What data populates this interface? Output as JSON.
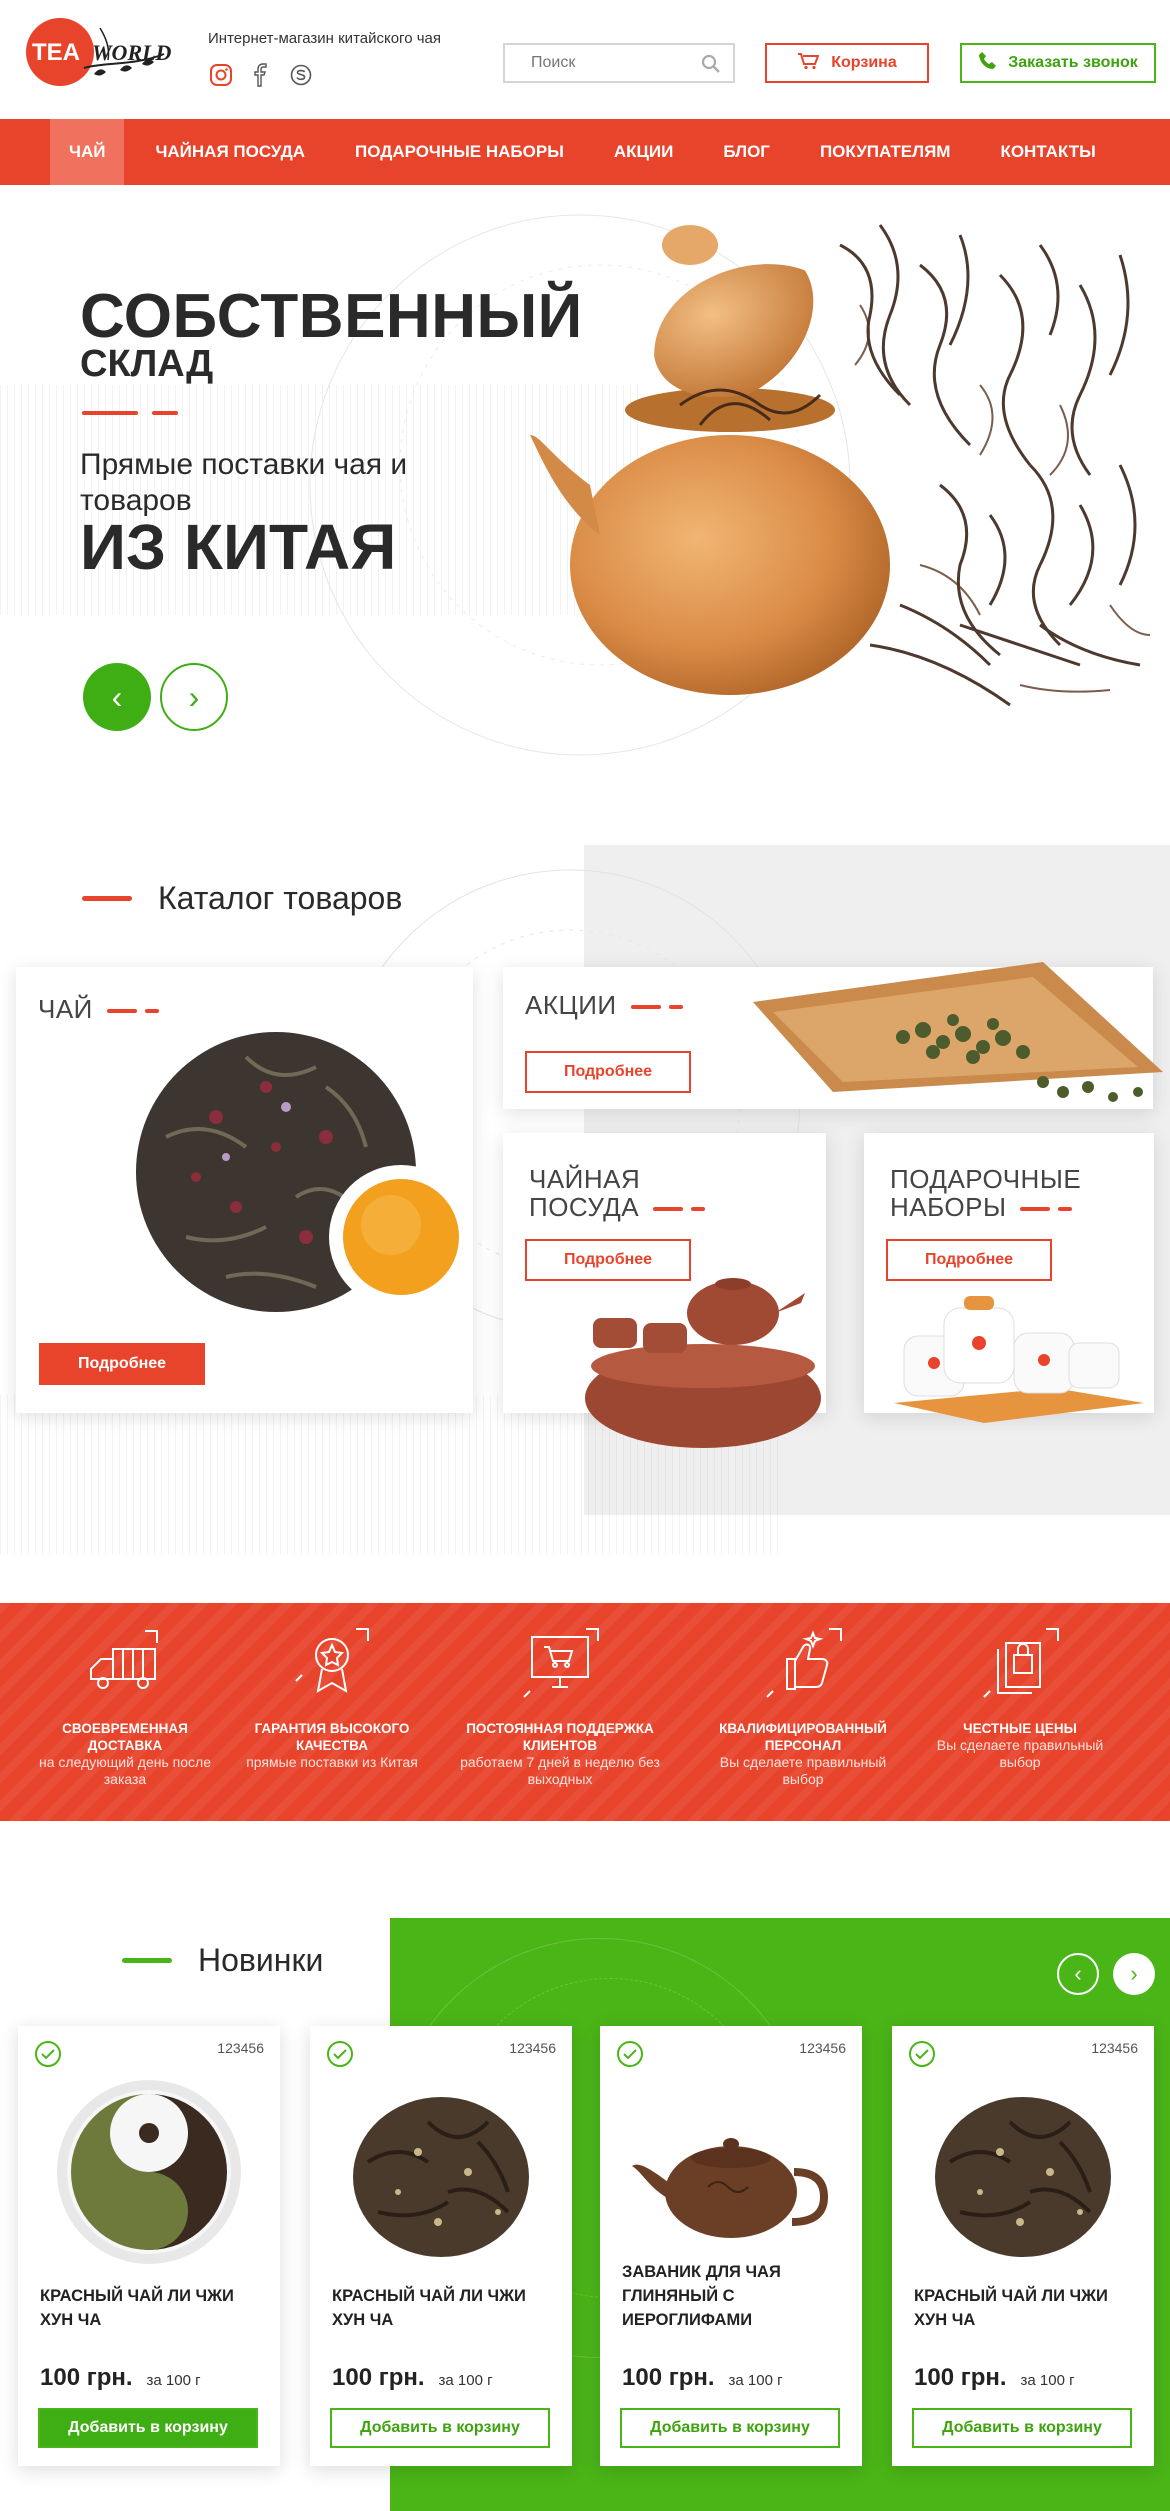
{
  "header": {
    "logo_text": "TEA WORLD",
    "tagline": "Интернет-магазин китайского чая",
    "socials": [
      "instagram-icon",
      "facebook-icon",
      "skype-icon"
    ],
    "search_placeholder": "Поиск",
    "cart_label": "Корзина",
    "call_label": "Заказать звонок"
  },
  "nav": {
    "items": [
      "Чай",
      "Чайная посуда",
      "Подарочные наборы",
      "Акции",
      "Блог",
      "Покупателям",
      "Контакты"
    ],
    "active_index": 0
  },
  "hero": {
    "title1": "СОБСТВЕННЫЙ",
    "title2": "СКЛАД",
    "subtitle": "Прямые поставки чая и товаров",
    "big": "ИЗ КИТАЯ",
    "prev_label": "‹",
    "next_label": "›"
  },
  "catalog": {
    "title": "Каталог товаров",
    "cards": [
      {
        "title": "Чай",
        "button": "Подробнее"
      },
      {
        "title": "Акции",
        "button": "Подробнее"
      },
      {
        "title": "Чайная посуда",
        "button": "Подробнее"
      },
      {
        "title": "Подарочные наборы",
        "button": "Подробнее"
      }
    ]
  },
  "features": [
    {
      "title": "Своевременная доставка",
      "desc": "на следующий день после заказа",
      "icon": "truck-icon"
    },
    {
      "title": "Гарантия высокого качества",
      "desc": "прямые поставки из Китая",
      "icon": "award-badge-icon"
    },
    {
      "title": "Постоянная поддержка клиентов",
      "desc": "работаем 7 дней в неделю без выходных",
      "icon": "monitor-cart-icon"
    },
    {
      "title": "Квалифицированный персонал",
      "desc": "Вы сделаете правильный выбор",
      "icon": "thumbs-up-icon"
    },
    {
      "title": "Честные цены",
      "desc": "Вы сделаете правильный выбор",
      "icon": "price-tag-icon"
    }
  ],
  "new_products": {
    "title": "Новинки",
    "items": [
      {
        "sku": "123456",
        "name": "Красный чай Ли Чжи Хун Ча",
        "price": "100 грн.",
        "unit": "за 100 г",
        "button": "Добавить в корзину",
        "image": "yin-yang-tea"
      },
      {
        "sku": "123456",
        "name": "Красный чай Ли Чжи Хун Ча",
        "price": "100 грн.",
        "unit": "за 100 г",
        "button": "Добавить в корзину",
        "image": "loose-tea"
      },
      {
        "sku": "123456",
        "name": "Заваник для чая глиняный с иероглифами",
        "price": "100 грн.",
        "unit": "за 100 г",
        "button": "Добавить в корзину",
        "image": "clay-teapot"
      },
      {
        "sku": "123456",
        "name": "Красный чай Ли Чжи Хун Ча",
        "price": "100 грн.",
        "unit": "за 100 г",
        "button": "Добавить в корзину",
        "image": "loose-tea"
      }
    ]
  },
  "colors": {
    "brand_red": "#e8442c",
    "brand_green": "#4ab517",
    "text_dark": "#2a2a2a"
  }
}
